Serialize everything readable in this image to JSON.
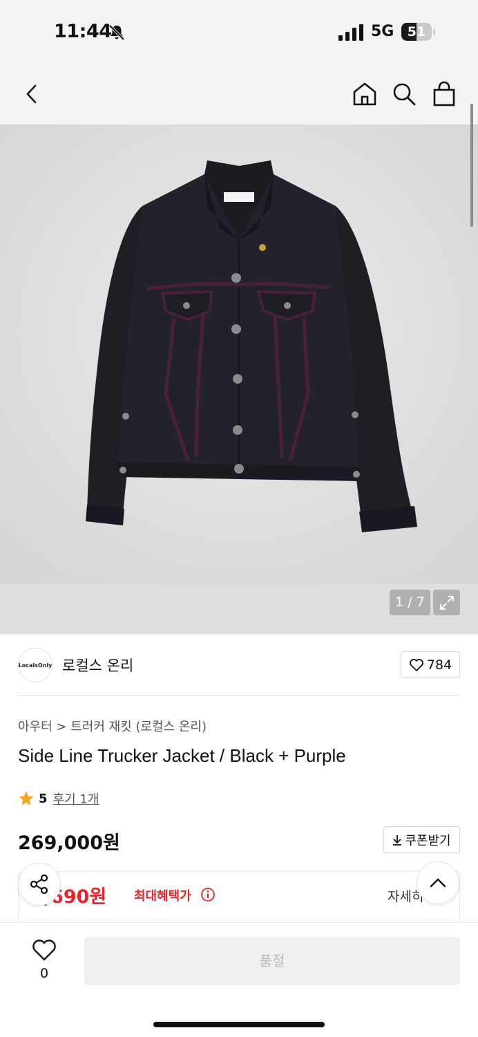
{
  "status_bar": {
    "time": "11:44",
    "network": "5G",
    "battery_percent": "51",
    "battery_level": 0.51,
    "icons": [
      "bell-slash-icon",
      "signal-icon",
      "battery-icon"
    ]
  },
  "nav": {
    "icons": [
      "back-icon",
      "home-icon",
      "search-icon",
      "shopping-bag-icon"
    ]
  },
  "gallery": {
    "counter": "1 / 7",
    "current": 1,
    "total": 7
  },
  "brand": {
    "logo_text": "LocalsOnly",
    "name": "로컬스 온리",
    "like_count": "784"
  },
  "product": {
    "breadcrumb": "아우터 > 트러커 재킷 (로컬스 온리)",
    "title": "Side Line Trucker Jacket / Black + Purple",
    "rating": "5",
    "rating_stars": 1,
    "review_link": "후기 1개",
    "price": "269,000원",
    "coupon_label": "쿠폰받기",
    "benefit_price": "3,690원",
    "benefit_label": "최대혜택가",
    "detail_link": "자세히"
  },
  "bottom_bar": {
    "wish_count": "0",
    "cta_label": "품절"
  },
  "colors": {
    "accent_red": "#e8262a",
    "star": "#f5a623",
    "jacket": "#1f2026",
    "trim": "#4a1f3c"
  }
}
